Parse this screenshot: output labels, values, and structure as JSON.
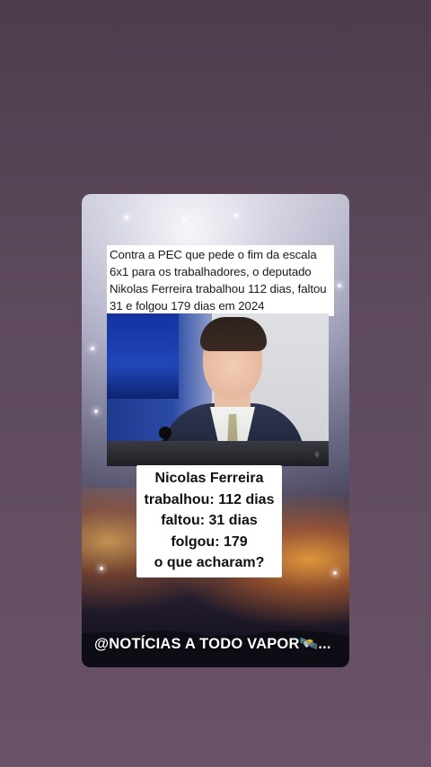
{
  "post": {
    "caption": "Contra a PEC que pede o fim da escala 6x1 para os trabalhadores, o deputado Nikolas Ferreira trabalhou 112 dias, faltou 31 e folgou 179 dias em 2024",
    "stats": {
      "line1": "Nicolas Ferreira",
      "line2": "trabalhou: 112 dias",
      "line3": "faltou: 31 dias",
      "line4": "folgou: 179",
      "line5": "o que acharam?"
    },
    "handle": "@NOTÍCIAS A TODO VAPOR🛰️..."
  },
  "icons": {
    "photo_watermark": "camara-logo-icon"
  },
  "colors": {
    "background": "#5a4759",
    "card_text": "#111111",
    "caption_bg": "#ffffff"
  }
}
